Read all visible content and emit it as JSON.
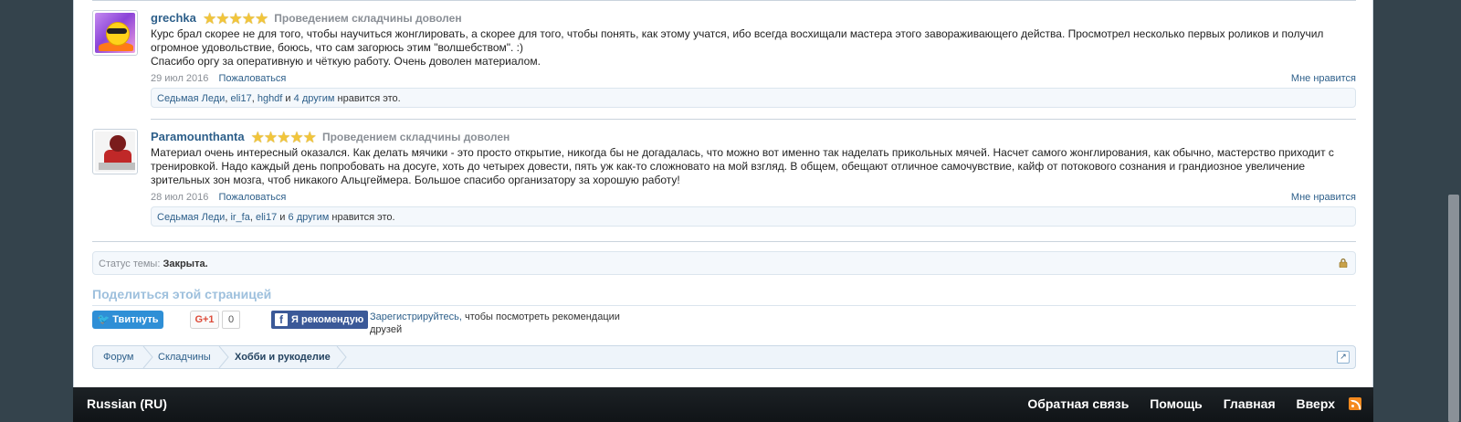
{
  "posts": [
    {
      "username": "grechka",
      "rating_stars": 5,
      "verdict": "Проведением складчины доволен",
      "message_lines": [
        "Курс брал скорее не для того, чтобы научиться жонглировать, а скорее для того, чтобы понять, как этому учатся, ибо всегда восхищали мастера этого завораживающего действа. Просмотрел несколько первых роликов и получил",
        "огромное удовольствие, боюсь, что сам загорюсь этим \"волшебством\". :)",
        "Спасибо оргу за оперативную и чёткую работу. Очень доволен материалом."
      ],
      "date": "29 июл 2016",
      "report": "Пожаловаться",
      "like": "Мне нравится",
      "likers": [
        "Седьмая Леди",
        "eli17",
        "hghdf"
      ],
      "and_word": "и",
      "others": "4 другим",
      "likes_suffix": "нравится это."
    },
    {
      "username": "Paramounthanta",
      "rating_stars": 5,
      "verdict": "Проведением складчины доволен",
      "message_lines": [
        "Материал очень интересный оказался. Как делать мячики - это просто открытие, никогда бы не догадалась, что можно вот именно так наделать прикольных мячей. Насчет самого жонглирования, как обычно, мастерство приходит с",
        "тренировкой. Надо каждый день попробовать на досуге, хоть до четырех довести, пять уж как-то сложновато на мой взгляд. В общем, обещают отличное самочувствие, кайф от потокового сознания и грандиозное увеличение",
        "зрительных зон мозга, чтоб никакого Альцгеймера. Большое спасибо организатору за хорошую работу!"
      ],
      "date": "28 июл 2016",
      "report": "Пожаловаться",
      "like": "Мне нравится",
      "likers": [
        "Седьмая Леди",
        "ir_fa",
        "eli17"
      ],
      "and_word": "и",
      "others": "6 другим",
      "likes_suffix": "нравится это."
    }
  ],
  "thread_status": {
    "label": "Статус темы:",
    "value": "Закрыта."
  },
  "share": {
    "title": "Поделиться этой страницей",
    "tweet": "Твитнуть",
    "gplus": "G+1",
    "gplus_count": "0",
    "fb_button": "Я рекомендую",
    "fb_register": "Зарегистрируйтесь,",
    "fb_text": "чтобы посмотреть рекомендации друзей"
  },
  "breadcrumbs": [
    "Форум",
    "Складчины",
    "Хобби и рукоделие"
  ],
  "footer": {
    "language": "Russian (RU)",
    "links": [
      "Обратная связь",
      "Помощь",
      "Главная",
      "Вверх"
    ]
  },
  "icons": {
    "lock": "lock-icon",
    "rss": "rss-icon",
    "jump": "jump-to-icon",
    "star": "star-icon"
  },
  "colors": {
    "link": "#2d5f8a",
    "page_bg": "#34434c",
    "star": "#f2c53a",
    "tweet": "#2f8fd6",
    "facebook": "#3b5998",
    "rss": "#f58a1f"
  }
}
